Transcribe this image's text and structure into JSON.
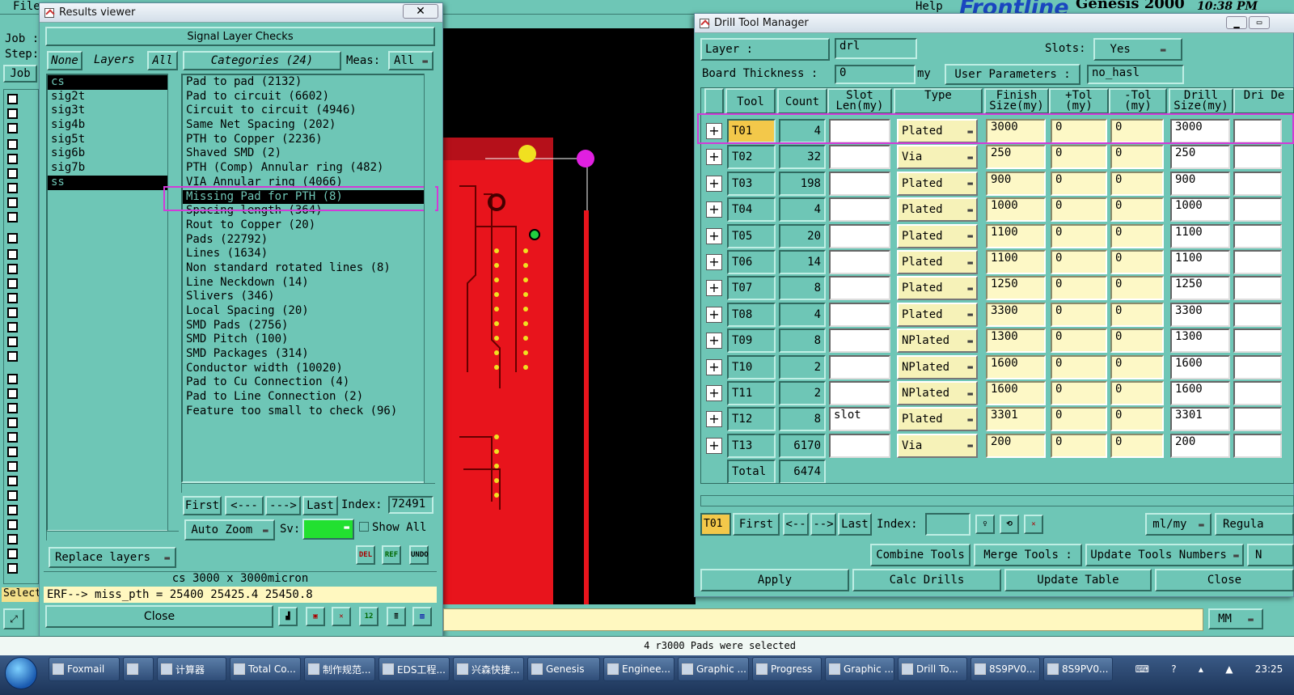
{
  "main": {
    "menu": [
      "File",
      "Help"
    ],
    "brand": "Frontline",
    "brand2": "Genesis 2000",
    "clock": "10:38 PM",
    "left_labels": [
      "Job :",
      "Step:",
      "Job"
    ],
    "select_label": "Select",
    "mm": "MM",
    "status_message": "4 r3000 Pads were selected"
  },
  "results": {
    "title": "Results viewer",
    "header": "Signal Layer Checks",
    "layers_none": "None",
    "layers_label": "Layers",
    "layers_all": "All",
    "layers": [
      "cs",
      "sig2t",
      "sig3t",
      "sig4b",
      "sig5t",
      "sig6b",
      "sig7b",
      "ss"
    ],
    "selected_layers": [
      0,
      7
    ],
    "categories_label": "Categories (24)",
    "meas_label": "Meas:",
    "meas_value": "All",
    "categories": [
      "Pad to pad (2132)",
      "Pad to circuit (6602)",
      "Circuit to circuit (4946)",
      "Same Net Spacing (202)",
      "PTH to Copper (2236)",
      "Shaved SMD (2)",
      "PTH (Comp) Annular ring (482)",
      "VIA Annular ring (4066)",
      "Missing Pad for PTH (8)",
      "Spacing length (364)",
      "Rout to Copper (20)",
      "Pads (22792)",
      "Lines (1634)",
      "Non standard rotated lines (8)",
      "Line Neckdown (14)",
      "Slivers (346)",
      "Local Spacing (20)",
      "SMD Pads (2756)",
      "SMD Pitch (100)",
      "SMD Packages (314)",
      "Conductor width (10020)",
      "Pad to Cu Connection (4)",
      "Pad to Line Connection (2)",
      "Feature too small to check (96)"
    ],
    "selected_category": 8,
    "nav": {
      "first": "First",
      "prev": "<---",
      "next": "--->",
      "last": "Last",
      "index_label": "Index:",
      "index_value": "72491"
    },
    "auto_zoom": "Auto Zoom",
    "sv_label": "Sv:",
    "show_all": "Show All",
    "replace_layers": "Replace layers",
    "icons": [
      "DEL",
      "REF",
      "UNDO"
    ],
    "measure_line": "cs 3000 x 3000micron",
    "erf_line": "ERF--> miss_pth = 25400 25425.4 25450.8",
    "close": "Close",
    "accent_highlight": "#d23ad8"
  },
  "drill": {
    "title": "Drill Tool Manager",
    "layer_label": "Layer :",
    "layer_value": "drl",
    "slots_label": "Slots:",
    "slots_value": "Yes",
    "thickness_label": "Board Thickness :",
    "thickness_value": "0",
    "thickness_unit": "my",
    "user_params_label": "User Parameters :",
    "user_params_value": "no_hasl",
    "columns": [
      "Tool",
      "Count",
      "Slot Len(my)",
      "Type",
      "Finish Size(my)",
      "+Tol (my)",
      "-Tol (my)",
      "Drill Size(my)",
      "Dri De"
    ],
    "rows": [
      {
        "tool": "T01",
        "count": "4",
        "slot": "",
        "type": "Plated",
        "finish": "3000",
        "ptol": "0",
        "mtol": "0",
        "drill": "3000"
      },
      {
        "tool": "T02",
        "count": "32",
        "slot": "",
        "type": "Via",
        "finish": "250",
        "ptol": "0",
        "mtol": "0",
        "drill": "250"
      },
      {
        "tool": "T03",
        "count": "198",
        "slot": "",
        "type": "Plated",
        "finish": "900",
        "ptol": "0",
        "mtol": "0",
        "drill": "900"
      },
      {
        "tool": "T04",
        "count": "4",
        "slot": "",
        "type": "Plated",
        "finish": "1000",
        "ptol": "0",
        "mtol": "0",
        "drill": "1000"
      },
      {
        "tool": "T05",
        "count": "20",
        "slot": "",
        "type": "Plated",
        "finish": "1100",
        "ptol": "0",
        "mtol": "0",
        "drill": "1100"
      },
      {
        "tool": "T06",
        "count": "14",
        "slot": "",
        "type": "Plated",
        "finish": "1100",
        "ptol": "0",
        "mtol": "0",
        "drill": "1100"
      },
      {
        "tool": "T07",
        "count": "8",
        "slot": "",
        "type": "Plated",
        "finish": "1250",
        "ptol": "0",
        "mtol": "0",
        "drill": "1250"
      },
      {
        "tool": "T08",
        "count": "4",
        "slot": "",
        "type": "Plated",
        "finish": "3300",
        "ptol": "0",
        "mtol": "0",
        "drill": "3300"
      },
      {
        "tool": "T09",
        "count": "8",
        "slot": "",
        "type": "NPlated",
        "finish": "1300",
        "ptol": "0",
        "mtol": "0",
        "drill": "1300"
      },
      {
        "tool": "T10",
        "count": "2",
        "slot": "",
        "type": "NPlated",
        "finish": "1600",
        "ptol": "0",
        "mtol": "0",
        "drill": "1600"
      },
      {
        "tool": "T11",
        "count": "2",
        "slot": "",
        "type": "NPlated",
        "finish": "1600",
        "ptol": "0",
        "mtol": "0",
        "drill": "1600"
      },
      {
        "tool": "T12",
        "count": "8",
        "slot": "slot",
        "type": "Plated",
        "finish": "3301",
        "ptol": "0",
        "mtol": "0",
        "drill": "3301"
      },
      {
        "tool": "T13",
        "count": "6170",
        "slot": "",
        "type": "Via",
        "finish": "200",
        "ptol": "0",
        "mtol": "0",
        "drill": "200"
      }
    ],
    "total_label": "Total",
    "total_value": "6474",
    "nav": {
      "current": "T01",
      "first": "First",
      "prev": "<--",
      "next": "-->",
      "last": "Last",
      "index_label": "Index:",
      "units": "ml/my",
      "regular": "Regula"
    },
    "buttons": {
      "combine": "Combine Tools",
      "merge": "Merge Tools :",
      "update_numbers": "Update Tools Numbers",
      "apply": "Apply",
      "calc": "Calc Drills",
      "update_table": "Update Table",
      "close": "Close"
    }
  },
  "taskbar": {
    "items": [
      "Foxmail",
      "",
      "计算器",
      "Total Co...",
      "制作规范...",
      "EDS工程...",
      "兴森快捷...",
      "Genesis",
      "Enginee...",
      "Graphic ...",
      "Progress",
      "Graphic ...",
      "Drill To...",
      "8S9PV0...",
      "8S9PV0..."
    ],
    "time": "23:25"
  },
  "colors": {
    "panel": "#6ec6b6",
    "board": "#e8141c",
    "highlight": "#d23ad8",
    "cell_yellow": "#fdf8c6",
    "tool_yellow": "#f3c84a"
  }
}
